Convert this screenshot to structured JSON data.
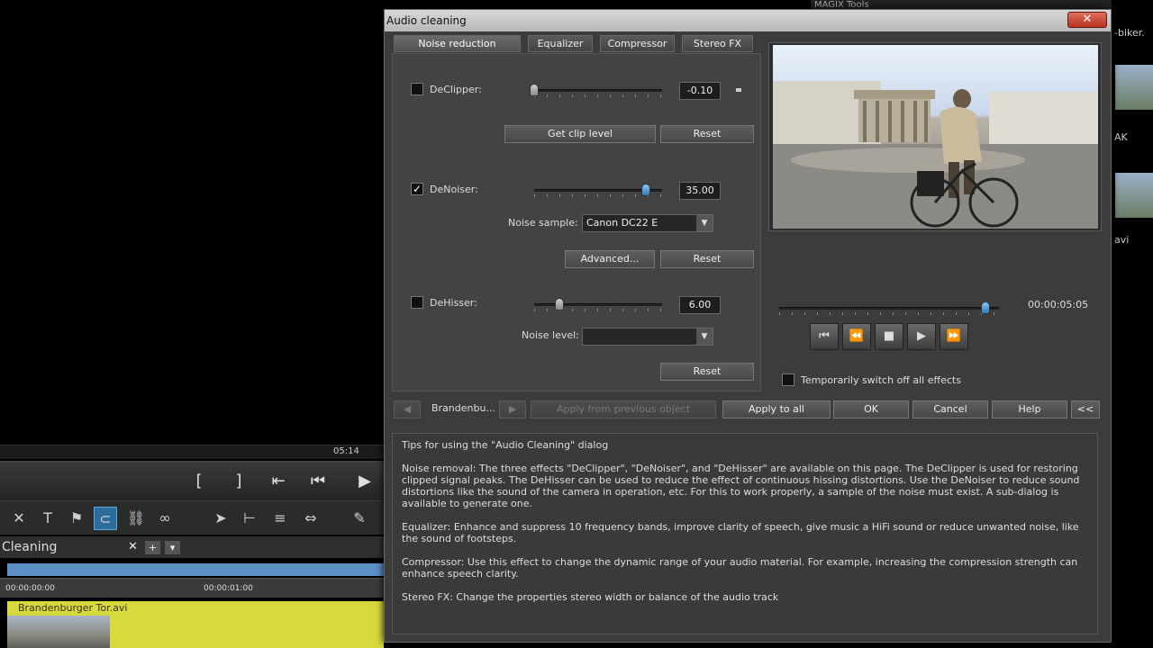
{
  "background": {
    "timecode": "05:14",
    "cleaning_tab": "Cleaning",
    "ruler_start": "00:00:00:00",
    "ruler_mid": "00:00:01:00",
    "clip_name": "Brandenburger Tor.avi",
    "right_texts": [
      "-biker.",
      "AK",
      "avi"
    ],
    "top_right_text": "MAGIX Tools"
  },
  "dialog": {
    "title": "Audio cleaning",
    "close_glyph": "✕",
    "tabs": [
      "Noise reduction",
      "Equalizer",
      "Compressor",
      "Stereo FX"
    ],
    "declipper": {
      "label": "DeClipper:",
      "value": "-0.10",
      "checked": false,
      "slider_fraction": 0.0,
      "get_clip_level": "Get clip level",
      "reset": "Reset"
    },
    "denoiser": {
      "label": "DeNoiser:",
      "value": "35.00",
      "checked": true,
      "slider_fraction": 0.87,
      "noise_sample_label": "Noise sample:",
      "noise_sample_value": "Canon DC22 E",
      "advanced": "Advanced...",
      "reset": "Reset"
    },
    "dehisser": {
      "label": "DeHisser:",
      "value": "6.00",
      "checked": false,
      "slider_fraction": 0.2,
      "noise_level_label": "Noise level:",
      "noise_level_value": "",
      "reset": "Reset"
    },
    "player": {
      "time": "00:00:05:05",
      "position_fraction": 0.94,
      "switch_off_label": "Temporarily switch off all effects"
    },
    "footer": {
      "object_name": "Brandenbu...",
      "apply_previous": "Apply from previous object",
      "apply_all": "Apply to all",
      "ok": "OK",
      "cancel": "Cancel",
      "help": "Help",
      "collapse": "<<"
    },
    "tips": {
      "title": "Tips for using the \"Audio Cleaning\" dialog",
      "noise_removal": "Noise removal: The three effects \"DeClipper\", \"DeNoiser\", and \"DeHisser\" are available on this page. The DeClipper is used for restoring clipped signal peaks. The DeHisser can be used to reduce the effect of continuous hissing distortions. Use the DeNoiser to reduce sound distortions like the sound of the camera in operation, etc. For this to work properly, a sample of the noise must exist. A sub-dialog is available to generate one.",
      "equalizer": "Equalizer: Enhance and suppress 10 frequency bands, improve clarity of speech, give music a HiFi sound or reduce unwanted noise, like the sound of footsteps.",
      "compressor": "Compressor: Use this effect to change the dynamic range of your audio material. For example, increasing the compression strength can enhance speech clarity.",
      "stereo_fx": "Stereo FX: Change the properties stereo width or balance of the audio track"
    }
  }
}
